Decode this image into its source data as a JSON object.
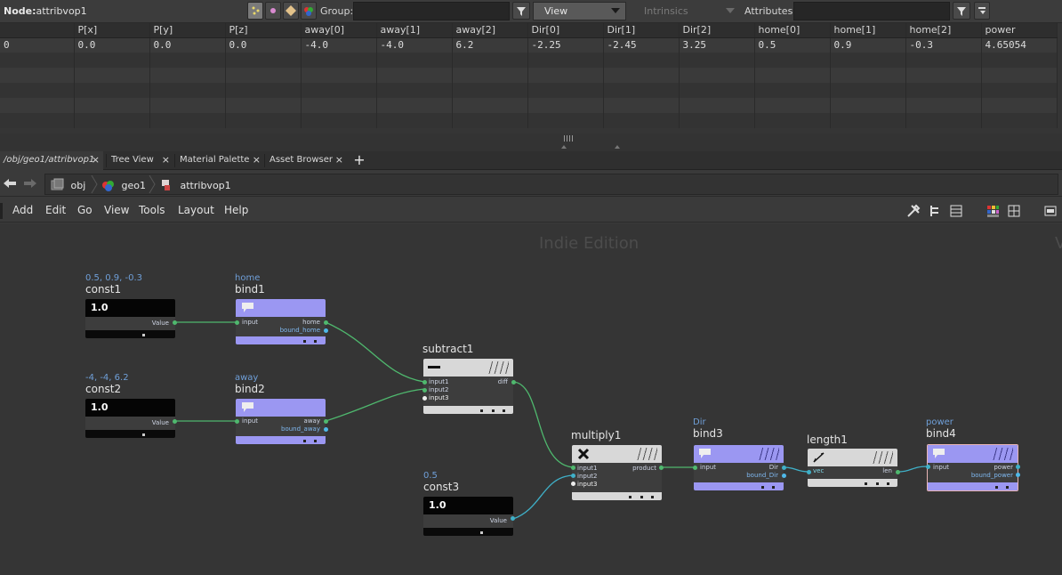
{
  "toolbar": {
    "node_label": "Node:",
    "node_name": "attribvop1",
    "group_label": "Group:",
    "group_value": "",
    "view_select": "View",
    "intrinsics_select": "Intrinsics",
    "attributes_label": "Attributes:",
    "attributes_value": ""
  },
  "spreadsheet": {
    "columns": [
      "",
      "P[x]",
      "P[y]",
      "P[z]",
      "away[0]",
      "away[1]",
      "away[2]",
      "Dir[0]",
      "Dir[1]",
      "Dir[2]",
      "home[0]",
      "home[1]",
      "home[2]",
      "power"
    ],
    "rows": [
      [
        "0",
        "0.0",
        "0.0",
        "0.0",
        "-4.0",
        "-4.0",
        "6.2",
        "-2.25",
        "-2.45",
        "3.25",
        "0.5",
        "0.9",
        "-0.3",
        "4.65054"
      ]
    ]
  },
  "tabs": [
    {
      "label": "/obj/geo1/attribvop1",
      "close": "×"
    },
    {
      "label": "Tree View",
      "close": "×"
    },
    {
      "label": "Material Palette",
      "close": "×"
    },
    {
      "label": "Asset Browser",
      "close": "×"
    }
  ],
  "add_tab": "+",
  "path": [
    "obj",
    "geo1",
    "attribvop1"
  ],
  "menu": [
    "Add",
    "Edit",
    "Go",
    "View",
    "Tools",
    "Layout",
    "Help"
  ],
  "watermark": "Indie Edition",
  "nodes": {
    "const1": {
      "comment": "0.5, 0.9, -0.3",
      "name": "const1",
      "value_badge": "1.0",
      "outputs": [
        "Value"
      ]
    },
    "const2": {
      "comment": "-4, -4, 6.2",
      "name": "const2",
      "value_badge": "1.0",
      "outputs": [
        "Value"
      ]
    },
    "const3": {
      "comment": "0.5",
      "name": "const3",
      "value_badge": "1.0",
      "outputs": [
        "Value"
      ]
    },
    "bind1": {
      "comment": "home",
      "name": "bind1",
      "inputs": [
        "input"
      ],
      "outputs": [
        "home",
        "bound_home"
      ]
    },
    "bind2": {
      "comment": "away",
      "name": "bind2",
      "inputs": [
        "input"
      ],
      "outputs": [
        "away",
        "bound_away"
      ]
    },
    "subtract1": {
      "name": "subtract1",
      "inputs": [
        "input1",
        "input2",
        "input3"
      ],
      "outputs": [
        "diff"
      ]
    },
    "multiply1": {
      "name": "multiply1",
      "inputs": [
        "input1",
        "input2",
        "input3"
      ],
      "outputs": [
        "product"
      ]
    },
    "bind3": {
      "comment": "Dir",
      "name": "bind3",
      "inputs": [
        "input"
      ],
      "outputs": [
        "Dir",
        "bound_Dir"
      ]
    },
    "length1": {
      "name": "length1",
      "inputs": [
        "vec"
      ],
      "outputs": [
        "len"
      ]
    },
    "bind4": {
      "comment": "power",
      "name": "bind4",
      "inputs": [
        "input"
      ],
      "outputs": [
        "power",
        "bound_power"
      ]
    }
  },
  "colors": {
    "bind": "#9b97f2",
    "const": "#050505",
    "math": "#d8d8d8",
    "wire_float": "#4fb86e",
    "wire_vector": "#3fb0c8",
    "port_vector": "#4fb8e8",
    "selected_outline": "#e8b4b4"
  }
}
